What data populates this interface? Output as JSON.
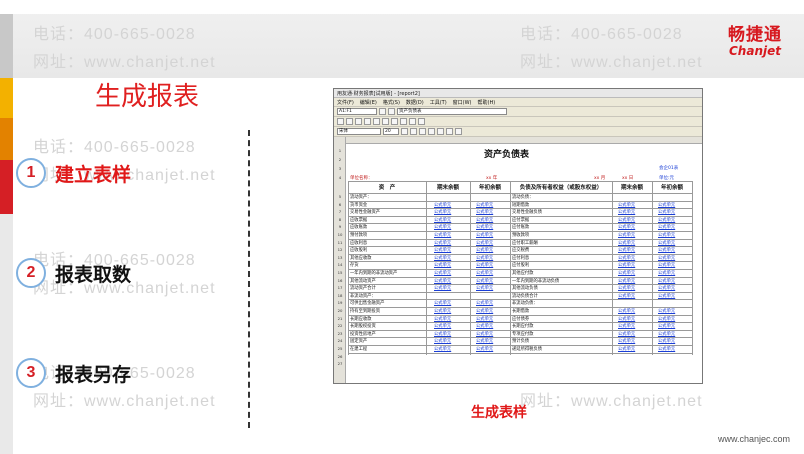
{
  "brand": {
    "cn": "畅捷通",
    "en": "Chanjet"
  },
  "title": "生成报表",
  "watermarks": {
    "phone": "电话：400-665-0028",
    "url": "网址：www.chanjet.net"
  },
  "steps": [
    {
      "num": "1",
      "label": "建立表样",
      "active": true
    },
    {
      "num": "2",
      "label": "报表取数",
      "active": false
    },
    {
      "num": "3",
      "label": "报表另存",
      "active": false
    }
  ],
  "caption": "生成表样",
  "footer": "www.chanjec.com",
  "colors": {
    "accent_red": "#d51f25",
    "link_blue": "#1a3ed6"
  },
  "app": {
    "window_title": "用友通·财务报表[试用版] - [report2]",
    "menu": [
      "文件(F)",
      "编辑(E)",
      "格式(S)",
      "数据(D)",
      "工具(T)",
      "窗口(W)",
      "帮助(H)"
    ],
    "cell_ref": "A1:F1",
    "formula_text": "资产负债表",
    "font_name": "宋体",
    "font_size": "20",
    "report": {
      "title": "资产负债表",
      "unit_label": "单位名称：",
      "year_label": "xx 年",
      "month_label": "xx 月",
      "date_label": "xx 日",
      "form_no": "会企01表",
      "currency": "单位:元",
      "headers": [
        "资　产",
        "期末余额",
        "年初余额",
        "负债及所有者权益（或股东权益）",
        "期末余额",
        "年初余额"
      ],
      "formula": "公式单元",
      "left_items": [
        "流动资产：",
        "货币资金",
        "交易性金融资产",
        "应收票据",
        "应收账款",
        "预付款项",
        "应收利息",
        "应收股利",
        "其他应收款",
        "存货",
        "一年内到期的非流动资产",
        "其他流动资产",
        "流动资产合计",
        "非流动资产：",
        "可供出售金融资产",
        "持有至到期投资",
        "长期应收款",
        "长期股权投资",
        "投资性房地产",
        "固定资产",
        "在建工程"
      ],
      "right_items": [
        "流动负债：",
        "短期借款",
        "交易性金融负债",
        "应付票据",
        "应付账款",
        "预收款项",
        "应付职工薪酬",
        "应交税费",
        "应付利息",
        "应付股利",
        "其他应付款",
        "一年内到期的非流动负债",
        "其他流动负债",
        "流动负债合计",
        "非流动负债：",
        "长期借款",
        "应付债券",
        "长期应付款",
        "专项应付款",
        "预计负债",
        "递延所得税负债"
      ],
      "row_numbers": [
        "1",
        "2",
        "3",
        "4",
        "5",
        "6",
        "7",
        "8",
        "9",
        "10",
        "11",
        "12",
        "13",
        "14",
        "15",
        "16",
        "17",
        "18",
        "19",
        "20",
        "21",
        "22",
        "23",
        "24",
        "25",
        "26",
        "27"
      ]
    }
  }
}
